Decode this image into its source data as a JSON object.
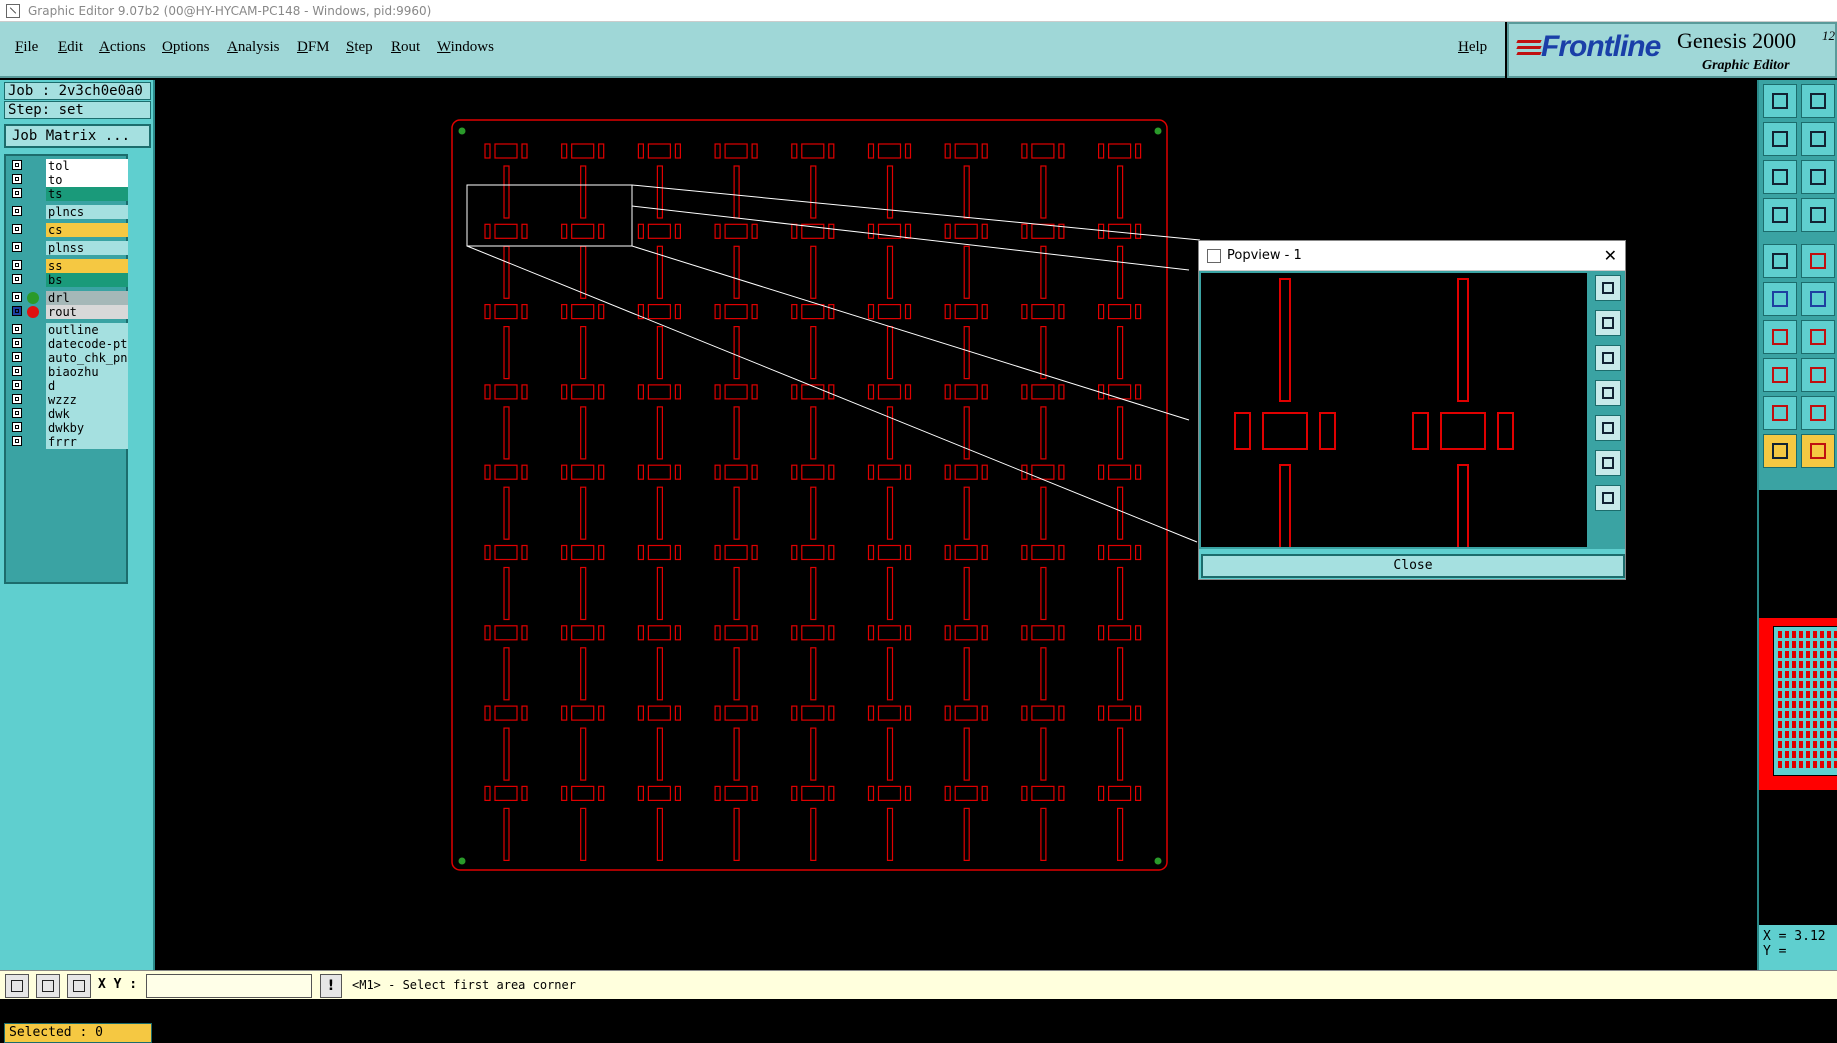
{
  "window": {
    "title": "Graphic Editor 9.07b2 (00@HY-HYCAM-PC148 - Windows, pid:9960)"
  },
  "menubar": {
    "items": [
      "File",
      "Edit",
      "Actions",
      "Options",
      "Analysis",
      "DFM",
      "Step",
      "Rout",
      "Windows"
    ],
    "help": "Help"
  },
  "logo": {
    "brand": "Frontline",
    "product": "Genesis 2000",
    "product_sup": "12",
    "product_sub": "Graphic Editor"
  },
  "job": {
    "job_line": "Job : 2v3ch0e0a0",
    "step_line": "Step: set",
    "matrix_button": "Job Matrix ..."
  },
  "layers": [
    {
      "name": "tol",
      "color": "#ffffff",
      "dot": ""
    },
    {
      "name": "to",
      "color": "#ffffff",
      "dot": ""
    },
    {
      "name": "ts",
      "color": "#1a9a7a",
      "dot": ""
    },
    {
      "name": "plncs",
      "color": "#a5e0e0",
      "dot": ""
    },
    {
      "name": "cs",
      "color": "#f5c842",
      "dot": ""
    },
    {
      "name": "plnss",
      "color": "#a5e0e0",
      "dot": ""
    },
    {
      "name": "ss",
      "color": "#f5c842",
      "dot": ""
    },
    {
      "name": "bs",
      "color": "#1a9a7a",
      "dot": ""
    },
    {
      "name": "drl",
      "color": "#a5b8b8",
      "dot": "#2a9a2a"
    },
    {
      "name": "rout",
      "color": "#d8d8d8",
      "dot": "#e01010"
    },
    {
      "name": "outline",
      "color": "#a5e0e0",
      "dot": ""
    },
    {
      "name": "datecode-ptc",
      "color": "#a5e0e0",
      "dot": ""
    },
    {
      "name": "auto_chk_pn",
      "color": "#a5e0e0",
      "dot": ""
    },
    {
      "name": "biaozhu",
      "color": "#a5e0e0",
      "dot": ""
    },
    {
      "name": "d",
      "color": "#a5e0e0",
      "dot": ""
    },
    {
      "name": "wzzz",
      "color": "#a5e0e0",
      "dot": ""
    },
    {
      "name": "dwk",
      "color": "#a5e0e0",
      "dot": ""
    },
    {
      "name": "dwkby",
      "color": "#a5e0e0",
      "dot": ""
    },
    {
      "name": "frrr",
      "color": "#a5e0e0",
      "dot": ""
    }
  ],
  "selected": "Selected : 0",
  "popview": {
    "title": "Popview - 1",
    "close_x": "✕",
    "close_button": "Close"
  },
  "coords": {
    "x": "X = 3.12",
    "y": "Y ="
  },
  "statusbar": {
    "xy_label": "X Y :",
    "xy_value": "",
    "exclaim": "!",
    "message": "<M1> - Select first area corner"
  },
  "colors": {
    "board_red": "#e00000",
    "panel_teal": "#5fcfcf"
  }
}
